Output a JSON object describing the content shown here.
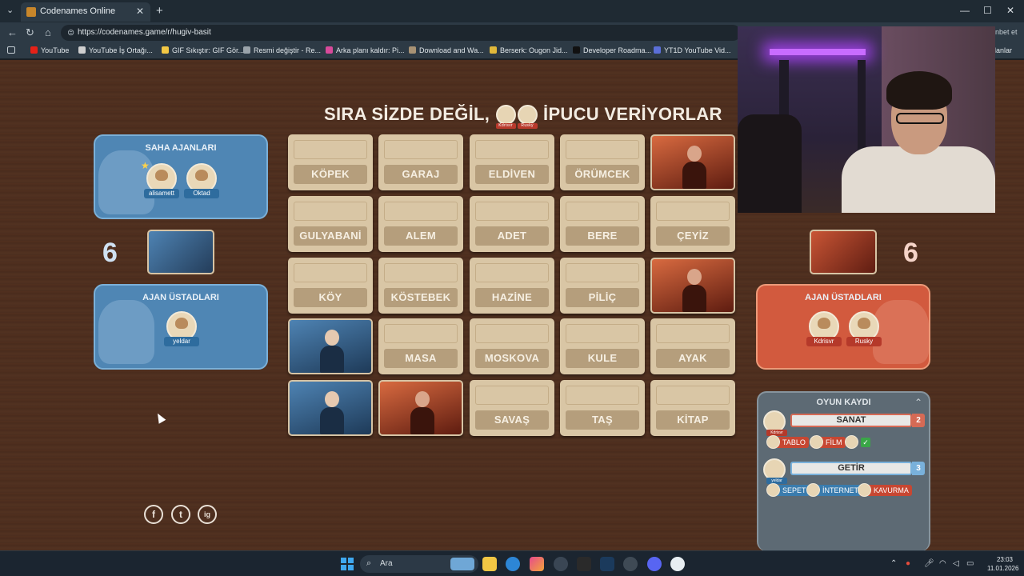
{
  "browser": {
    "tab_title": "Codenames Online",
    "url": "https://codenames.game/r/hugiv-basit",
    "nav_right_text": "nbet et",
    "bookmarks": [
      {
        "label": "YouTube",
        "color": "#e62117"
      },
      {
        "label": "YouTube İş Ortağı...",
        "color": "#cfcfcf"
      },
      {
        "label": "GIF Sıkıştır: GIF Gör...",
        "color": "#f2c744"
      },
      {
        "label": "Resmi değiştir - Re...",
        "color": "#9aa3aa"
      },
      {
        "label": "Arka planı kaldır: Pi...",
        "color": "#d84a9a"
      },
      {
        "label": "Download and Wa...",
        "color": "#a89274"
      },
      {
        "label": "Berserk: Ougon Jid...",
        "color": "#e0b83a"
      },
      {
        "label": "Developer Roadma...",
        "color": "#111111"
      },
      {
        "label": "YT1D YouTube Vid...",
        "color": "#5b6fd8"
      }
    ],
    "bookmarks_right": "lanlar"
  },
  "game": {
    "headline_pre": "SIRA SİZDE DEĞİL,",
    "headline_post": "İPUCU VERİYORLAR",
    "headline_tags": [
      "Kdrisvr",
      "Rusky"
    ],
    "blue_team": {
      "field_title": "SAHA AJANLARI",
      "field_players": [
        "alisamett",
        "Oktad"
      ],
      "score": "6",
      "spymaster_title": "AJAN ÜSTADLARI",
      "spymasters": [
        "yeldar"
      ]
    },
    "red_team": {
      "score": "6",
      "spymaster_title": "AJAN ÜSTADLARI",
      "spymasters": [
        "Kdrisvr",
        "Rusky"
      ]
    },
    "cards": [
      {
        "word": "KÖPEK",
        "state": "hidden"
      },
      {
        "word": "GARAJ",
        "state": "hidden"
      },
      {
        "word": "ELDİVEN",
        "state": "hidden"
      },
      {
        "word": "ÖRÜMCEK",
        "state": "hidden"
      },
      {
        "word": "",
        "state": "red"
      },
      {
        "word": "GULYABANİ",
        "state": "hidden"
      },
      {
        "word": "ALEM",
        "state": "hidden"
      },
      {
        "word": "ADET",
        "state": "hidden"
      },
      {
        "word": "BERE",
        "state": "hidden"
      },
      {
        "word": "ÇEYİZ",
        "state": "hidden"
      },
      {
        "word": "KÖY",
        "state": "hidden"
      },
      {
        "word": "KÖSTEBEK",
        "state": "hidden"
      },
      {
        "word": "HAZİNE",
        "state": "hidden"
      },
      {
        "word": "PİLİÇ",
        "state": "hidden"
      },
      {
        "word": "",
        "state": "red"
      },
      {
        "word": "",
        "state": "blue"
      },
      {
        "word": "MASA",
        "state": "hidden"
      },
      {
        "word": "MOSKOVA",
        "state": "hidden"
      },
      {
        "word": "KULE",
        "state": "hidden"
      },
      {
        "word": "AYAK",
        "state": "hidden"
      },
      {
        "word": "",
        "state": "blue"
      },
      {
        "word": "",
        "state": "red"
      },
      {
        "word": "SAVAŞ",
        "state": "hidden"
      },
      {
        "word": "TAŞ",
        "state": "hidden"
      },
      {
        "word": "KİTAP",
        "state": "hidden"
      }
    ],
    "log": {
      "title": "OYUN KAYDI",
      "clues": [
        {
          "giver": "Kdrisvr",
          "team": "red",
          "word": "SANAT",
          "number": "2",
          "guesses": [
            {
              "word": "TABLO",
              "team": "red"
            },
            {
              "word": "FİLM",
              "team": "red"
            },
            {
              "word": "",
              "team": "check"
            }
          ]
        },
        {
          "giver": "yeldar",
          "team": "blue",
          "word": "GETİR",
          "number": "3",
          "guesses": [
            {
              "word": "SEPET",
              "team": "blue"
            },
            {
              "word": "İNTERNET",
              "team": "blue"
            },
            {
              "word": "KAVURMA",
              "team": "red"
            }
          ]
        }
      ]
    },
    "social": [
      "f",
      "t",
      "ig"
    ]
  },
  "taskbar": {
    "search_placeholder": "Ara",
    "time": "23:03",
    "date": "11.01.2026"
  },
  "colors": {
    "blue_team": "#4f86b4",
    "red_team": "#d25a3e",
    "card_tan": "#d9c6a5"
  }
}
